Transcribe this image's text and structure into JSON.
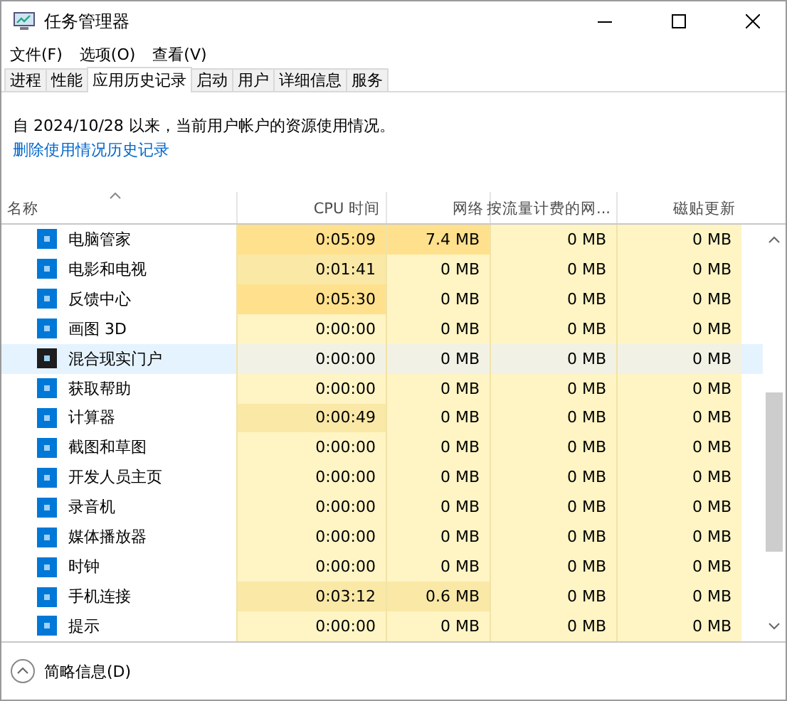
{
  "window": {
    "title": "任务管理器"
  },
  "menu": [
    "文件(F)",
    "选项(O)",
    "查看(V)"
  ],
  "tabs": [
    {
      "label": "进程",
      "selected": false
    },
    {
      "label": "性能",
      "selected": false
    },
    {
      "label": "应用历史记录",
      "selected": true
    },
    {
      "label": "启动",
      "selected": false
    },
    {
      "label": "用户",
      "selected": false
    },
    {
      "label": "详细信息",
      "selected": false
    },
    {
      "label": "服务",
      "selected": false
    }
  ],
  "description": "自 2024/10/28 以来，当前用户帐户的资源使用情况。",
  "delete_link": "删除使用情况历史记录",
  "table": {
    "columns": [
      "名称",
      "CPU 时间",
      "网络",
      "按流量计费的网...",
      "磁贴更新"
    ],
    "rows": [
      {
        "color": "#0078d7",
        "selected": false,
        "cells": [
          {
            "text": "电脑管家"
          },
          {
            "text": "0:05:09",
            "color": "#ffe08c"
          },
          {
            "text": "7.4 MB",
            "color": "#ffe08c"
          },
          {
            "text": "0 MB",
            "color": "#fff4c4"
          },
          {
            "text": "0 MB",
            "color": "#fff4c4"
          }
        ]
      },
      {
        "color": "#0078d7",
        "selected": false,
        "cells": [
          {
            "text": "电影和电视"
          },
          {
            "text": "0:01:41",
            "color": "#f9e8a6"
          },
          {
            "text": "0 MB",
            "color": "#fff4c4"
          },
          {
            "text": "0 MB",
            "color": "#fff4c4"
          },
          {
            "text": "0 MB",
            "color": "#fff4c4"
          }
        ]
      },
      {
        "color": "#0078d7",
        "selected": false,
        "cells": [
          {
            "text": "反馈中心"
          },
          {
            "text": "0:05:30",
            "color": "#ffe08c"
          },
          {
            "text": "0 MB",
            "color": "#fff4c4"
          },
          {
            "text": "0 MB",
            "color": "#fff4c4"
          },
          {
            "text": "0 MB",
            "color": "#fff4c4"
          }
        ]
      },
      {
        "color": "#0078d7",
        "selected": false,
        "cells": [
          {
            "text": "画图 3D"
          },
          {
            "text": "0:00:00",
            "color": "#fff4c4"
          },
          {
            "text": "0 MB",
            "color": "#fff4c4"
          },
          {
            "text": "0 MB",
            "color": "#fff4c4"
          },
          {
            "text": "0 MB",
            "color": "#fff4c4"
          }
        ]
      },
      {
        "color": "#1e1e1e",
        "selected": true,
        "cells": [
          {
            "text": "混合现实门户"
          },
          {
            "text": "0:00:00",
            "color": "#f1f1e5"
          },
          {
            "text": "0 MB",
            "color": "#f1f1e5"
          },
          {
            "text": "0 MB",
            "color": "#f1f1e5"
          },
          {
            "text": "0 MB",
            "color": "#f1f1e5"
          }
        ]
      },
      {
        "color": "#0078d7",
        "selected": false,
        "cells": [
          {
            "text": "获取帮助"
          },
          {
            "text": "0:00:00",
            "color": "#fff4c4"
          },
          {
            "text": "0 MB",
            "color": "#fff4c4"
          },
          {
            "text": "0 MB",
            "color": "#fff4c4"
          },
          {
            "text": "0 MB",
            "color": "#fff4c4"
          }
        ]
      },
      {
        "color": "#0078d7",
        "selected": false,
        "cells": [
          {
            "text": "计算器"
          },
          {
            "text": "0:00:49",
            "color": "#f9e8a6"
          },
          {
            "text": "0 MB",
            "color": "#fff4c4"
          },
          {
            "text": "0 MB",
            "color": "#fff4c4"
          },
          {
            "text": "0 MB",
            "color": "#fff4c4"
          }
        ]
      },
      {
        "color": "#0078d7",
        "selected": false,
        "cells": [
          {
            "text": "截图和草图"
          },
          {
            "text": "0:00:00",
            "color": "#fff4c4"
          },
          {
            "text": "0 MB",
            "color": "#fff4c4"
          },
          {
            "text": "0 MB",
            "color": "#fff4c4"
          },
          {
            "text": "0 MB",
            "color": "#fff4c4"
          }
        ]
      },
      {
        "color": "#0078d7",
        "selected": false,
        "cells": [
          {
            "text": "开发人员主页"
          },
          {
            "text": "0:00:00",
            "color": "#fff4c4"
          },
          {
            "text": "0 MB",
            "color": "#fff4c4"
          },
          {
            "text": "0 MB",
            "color": "#fff4c4"
          },
          {
            "text": "0 MB",
            "color": "#fff4c4"
          }
        ]
      },
      {
        "color": "#0078d7",
        "selected": false,
        "cells": [
          {
            "text": "录音机"
          },
          {
            "text": "0:00:00",
            "color": "#fff4c4"
          },
          {
            "text": "0 MB",
            "color": "#fff4c4"
          },
          {
            "text": "0 MB",
            "color": "#fff4c4"
          },
          {
            "text": "0 MB",
            "color": "#fff4c4"
          }
        ]
      },
      {
        "color": "#0078d7",
        "selected": false,
        "cells": [
          {
            "text": "媒体播放器"
          },
          {
            "text": "0:00:00",
            "color": "#fff4c4"
          },
          {
            "text": "0 MB",
            "color": "#fff4c4"
          },
          {
            "text": "0 MB",
            "color": "#fff4c4"
          },
          {
            "text": "0 MB",
            "color": "#fff4c4"
          }
        ]
      },
      {
        "color": "#0078d7",
        "selected": false,
        "cells": [
          {
            "text": "时钟"
          },
          {
            "text": "0:00:00",
            "color": "#fff4c4"
          },
          {
            "text": "0 MB",
            "color": "#fff4c4"
          },
          {
            "text": "0 MB",
            "color": "#fff4c4"
          },
          {
            "text": "0 MB",
            "color": "#fff4c4"
          }
        ]
      },
      {
        "color": "#0078d7",
        "selected": false,
        "cells": [
          {
            "text": "手机连接"
          },
          {
            "text": "0:03:12",
            "color": "#f9e8a6"
          },
          {
            "text": "0.6 MB",
            "color": "#f9e8a6"
          },
          {
            "text": "0 MB",
            "color": "#fff4c4"
          },
          {
            "text": "0 MB",
            "color": "#fff4c4"
          }
        ]
      },
      {
        "color": "#0078d7",
        "selected": false,
        "cells": [
          {
            "text": "提示"
          },
          {
            "text": "0:00:00",
            "color": "#fff4c4"
          },
          {
            "text": "0 MB",
            "color": "#fff4c4"
          },
          {
            "text": "0 MB",
            "color": "#fff4c4"
          },
          {
            "text": "0 MB",
            "color": "#fff4c4"
          }
        ]
      }
    ]
  },
  "footer": {
    "label": "简略信息(D)"
  }
}
